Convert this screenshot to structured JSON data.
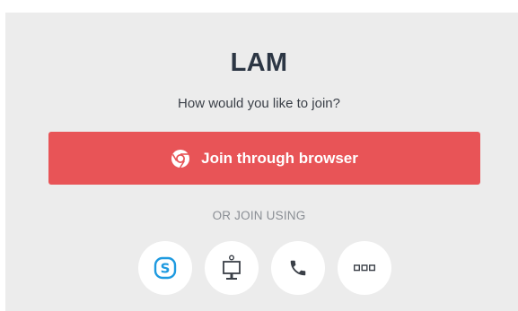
{
  "meeting": {
    "title": "LAM",
    "prompt": "How would you like to join?"
  },
  "join_browser": {
    "label": "Join through browser",
    "icon": "chrome-icon",
    "color": "#e85457"
  },
  "alt_join": {
    "label": "OR JOIN USING",
    "options": [
      {
        "icon": "skype-icon",
        "color": "#1e9ae0"
      },
      {
        "icon": "room-system-icon",
        "color": "#3a3f47"
      },
      {
        "icon": "phone-icon",
        "color": "#3a3f47"
      },
      {
        "icon": "more-options-icon",
        "color": "#3a3f47"
      }
    ]
  }
}
